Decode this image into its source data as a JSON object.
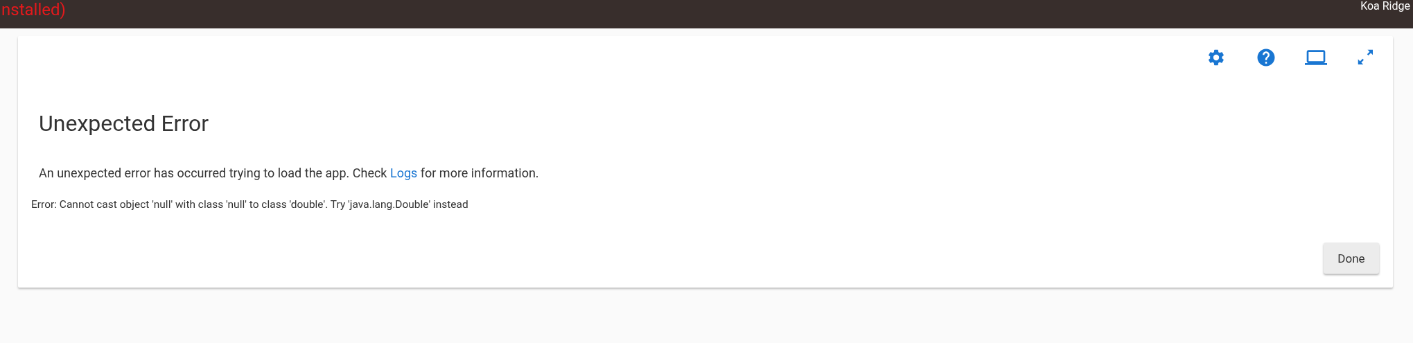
{
  "header": {
    "title": "nstalled)",
    "location": "Koa Ridge"
  },
  "toolbar": {
    "buttons": [
      {
        "kind": "settings"
      },
      {
        "kind": "help"
      },
      {
        "kind": "screen"
      },
      {
        "kind": "fullscreen"
      }
    ]
  },
  "dialog": {
    "title": "Unexpected Error",
    "message": {
      "before": "An unexpected error has occurred trying to load the app. Check ",
      "link": "Logs",
      "after": " for more information."
    },
    "detail": "Error: Cannot cast object 'null' with class 'null' to class 'double'. Try 'java.lang.Double' instead",
    "buttons": [
      "Done"
    ]
  }
}
